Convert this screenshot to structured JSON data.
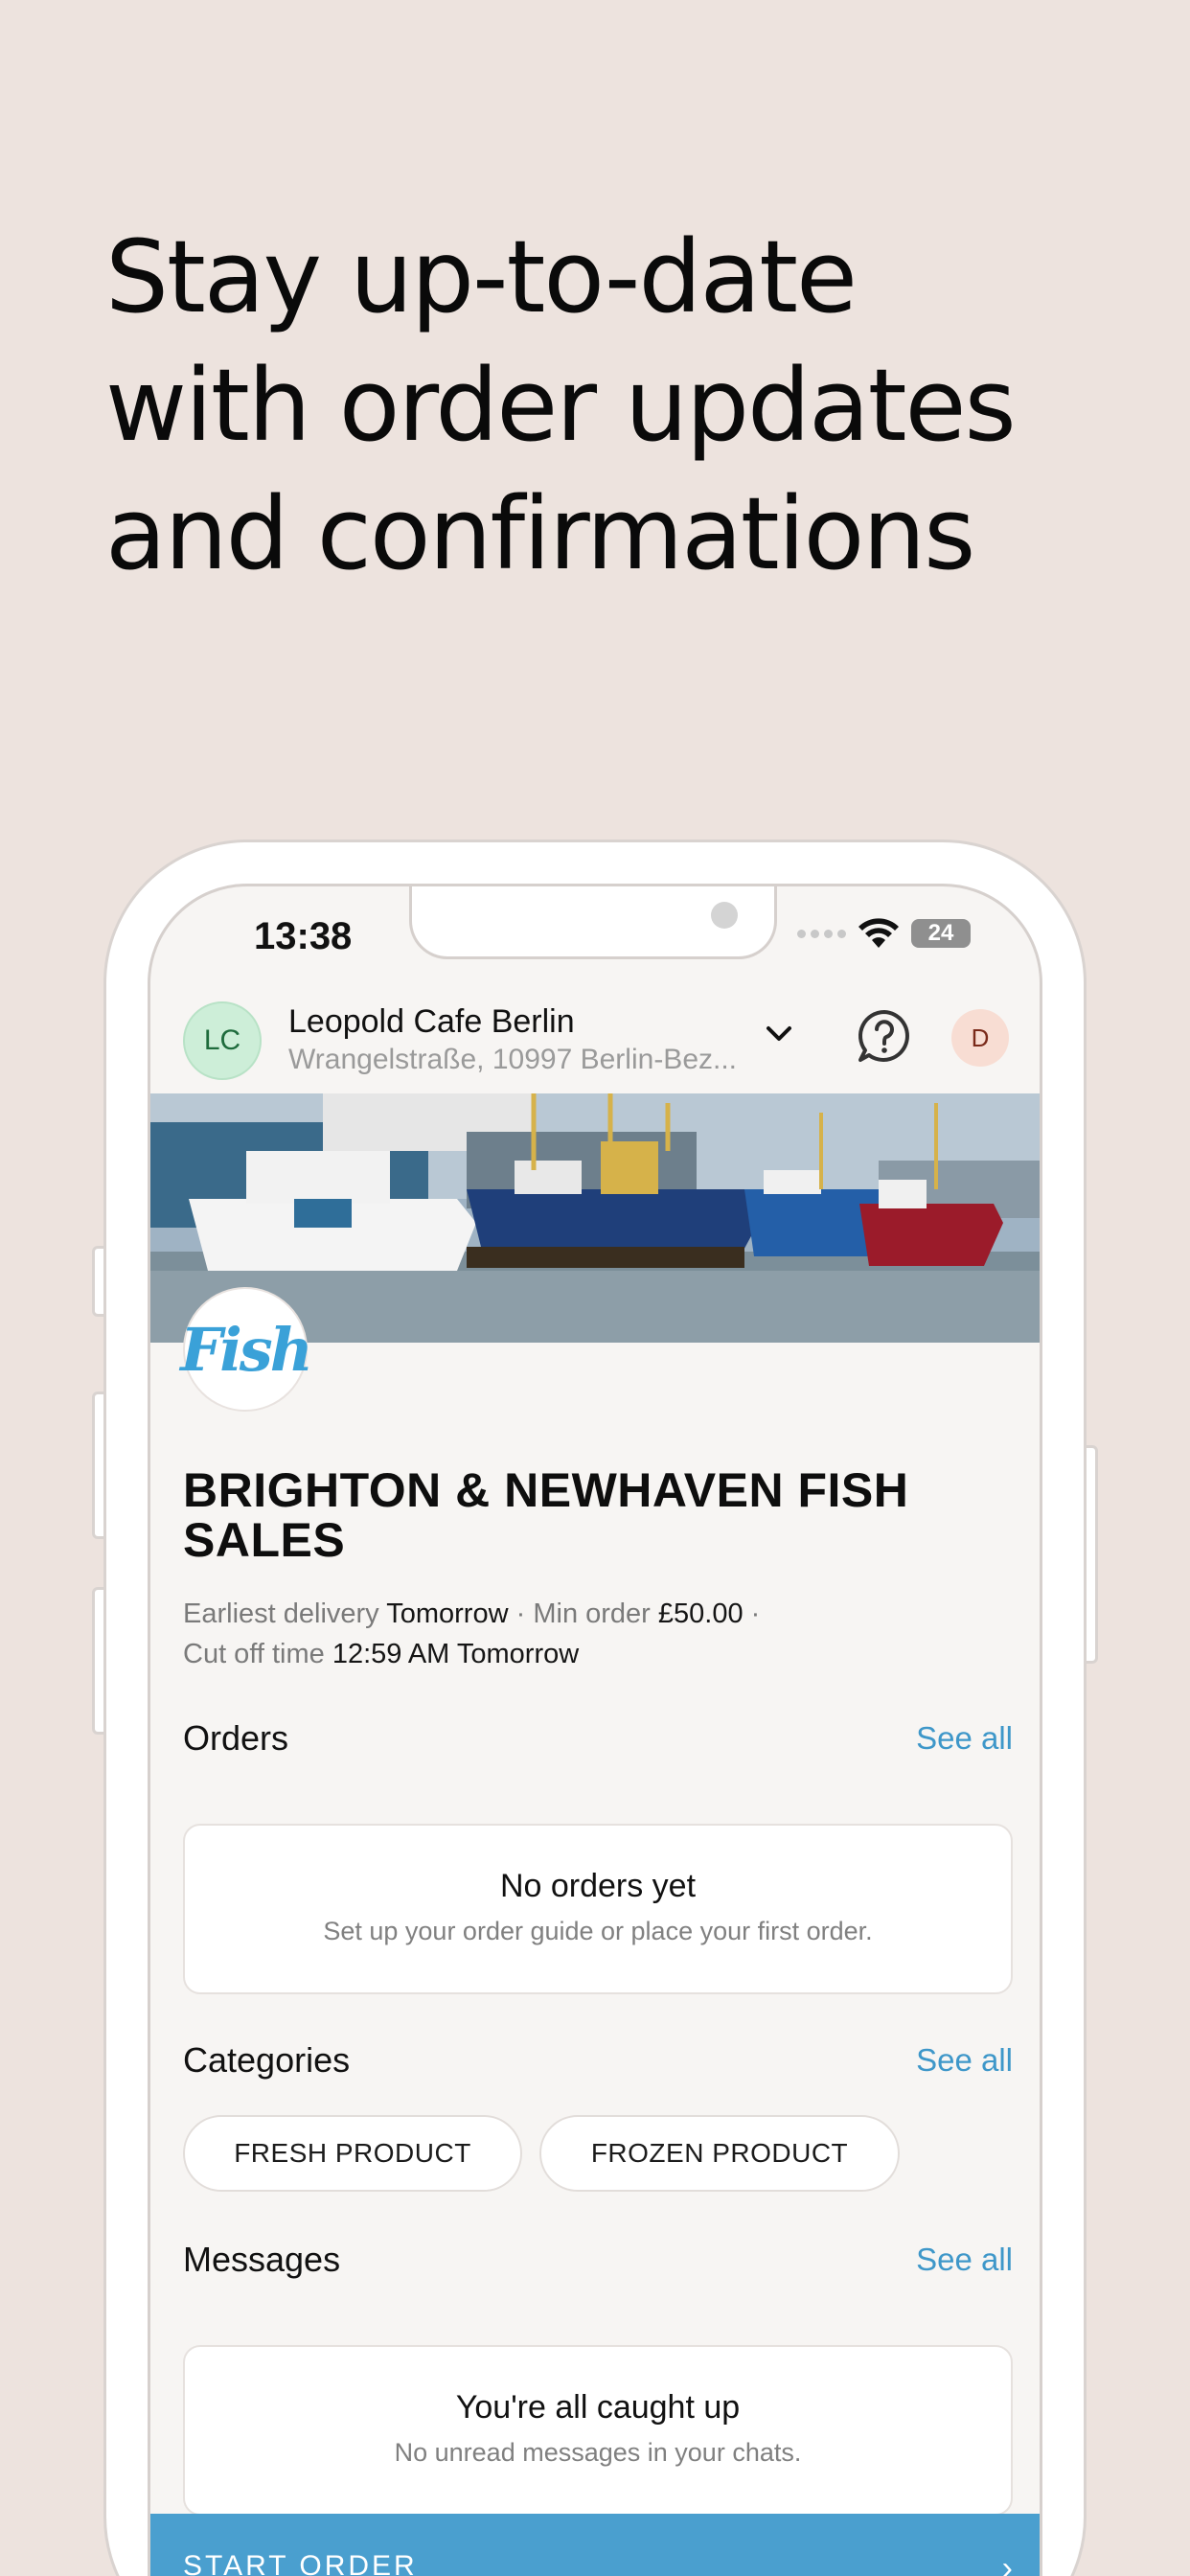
{
  "headline": {
    "line1": "Stay up-to-date",
    "line2": "with order updates",
    "line3": "and confirmations"
  },
  "status_bar": {
    "time": "13:38",
    "battery": "24"
  },
  "header": {
    "avatar_initials": "LC",
    "venue_name": "Leopold Cafe Berlin",
    "venue_address": "Wrangelstraße, 10997 Berlin-Bez...",
    "user_initial": "D"
  },
  "supplier": {
    "logo_text": "Fish",
    "name": "BRIGHTON & NEWHAVEN FISH SALES",
    "earliest_delivery_label": "Earliest delivery",
    "earliest_delivery_value": "Tomorrow",
    "min_order_label": "Min order",
    "min_order_value": "£50.00",
    "cutoff_label": "Cut off time",
    "cutoff_value": "12:59 AM Tomorrow",
    "separator": "·"
  },
  "orders": {
    "title": "Orders",
    "see_all": "See all",
    "empty_title": "No orders yet",
    "empty_sub": "Set up your order guide or place your first order."
  },
  "categories": {
    "title": "Categories",
    "see_all": "See all",
    "items": [
      "FRESH PRODUCT",
      "FROZEN PRODUCT"
    ]
  },
  "messages": {
    "title": "Messages",
    "see_all": "See all",
    "empty_title": "You're all caught up",
    "empty_sub": "No unread messages in your chats."
  },
  "cta": {
    "label": "START ORDER",
    "arrow": "›"
  },
  "colors": {
    "background": "#ede3de",
    "accent": "#4a9fcf",
    "link": "#3e97c9"
  }
}
